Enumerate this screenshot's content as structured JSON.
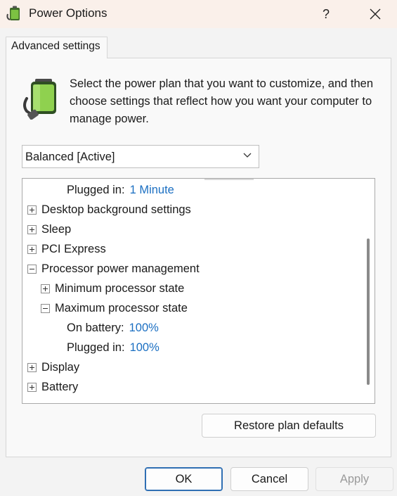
{
  "window": {
    "title": "Power Options",
    "help_label": "?",
    "close_label": "×"
  },
  "tab": {
    "label": "Advanced settings"
  },
  "description": "Select the power plan that you want to customize, and then choose settings that reflect how you want your computer to manage power.",
  "plan_select": {
    "value": "Balanced [Active]"
  },
  "tree": {
    "items": [
      {
        "label": "Plugged in:",
        "value": "1 Minute",
        "level": 2,
        "expander": "none"
      },
      {
        "label": "Desktop background settings",
        "level": 0,
        "expander": "plus"
      },
      {
        "label": "Sleep",
        "level": 0,
        "expander": "plus"
      },
      {
        "label": "PCI Express",
        "level": 0,
        "expander": "plus"
      },
      {
        "label": "Processor power management",
        "level": 0,
        "expander": "minus"
      },
      {
        "label": "Minimum processor state",
        "level": 1,
        "expander": "plus"
      },
      {
        "label": "Maximum processor state",
        "level": 1,
        "expander": "minus"
      },
      {
        "label": "On battery:",
        "value": "100%",
        "level": 2,
        "expander": "none"
      },
      {
        "label": "Plugged in:",
        "value": "100%",
        "level": 2,
        "expander": "none"
      },
      {
        "label": "Display",
        "level": 0,
        "expander": "plus"
      },
      {
        "label": "Battery",
        "level": 0,
        "expander": "plus"
      }
    ]
  },
  "buttons": {
    "restore": "Restore plan defaults",
    "ok": "OK",
    "cancel": "Cancel",
    "apply": "Apply"
  },
  "colors": {
    "value_text": "#1b6fc2",
    "title_bar": "#faf0ea",
    "accent_border": "#2f6fb3"
  }
}
